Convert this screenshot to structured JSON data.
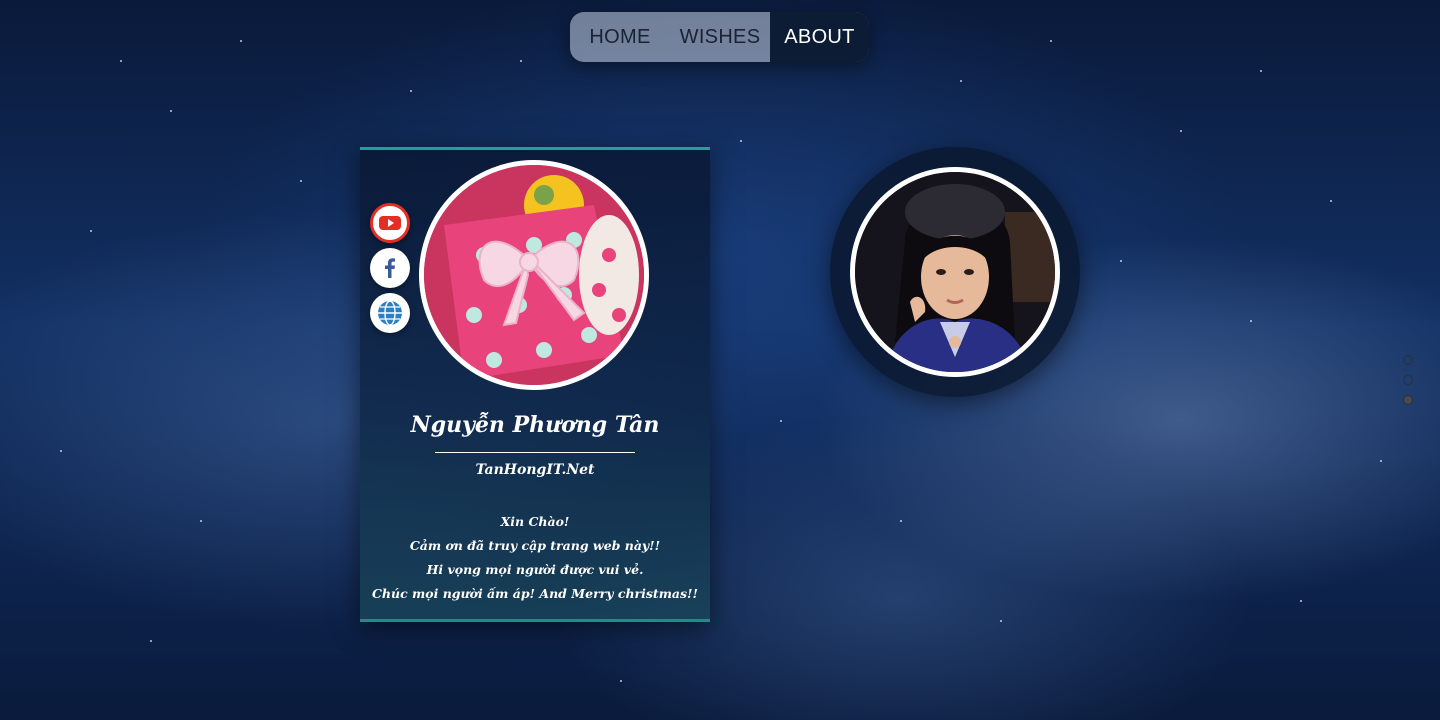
{
  "nav": {
    "items": [
      {
        "label": "HOME"
      },
      {
        "label": "WISHES"
      },
      {
        "label": "ABOUT",
        "active": true
      }
    ]
  },
  "profile_card": {
    "name": "Nguyễn Phương Tân",
    "site": "TanHongIT.Net",
    "message": [
      "Xin Chào!",
      "Cảm ơn đã truy cập trang web này!!",
      "Hi vọng mọi người được vui vẻ.",
      "Chúc mọi người ấm áp! And Merry christmas!!"
    ],
    "social_icons": [
      "youtube-icon",
      "facebook-icon",
      "globe-icon"
    ]
  },
  "colors": {
    "accent": "#1aa39a",
    "youtube": "#e52d27",
    "facebook": "#3b5998",
    "nav_active_bg": "#0c1c34"
  },
  "slider": {
    "total": 3,
    "active_index": 2
  }
}
